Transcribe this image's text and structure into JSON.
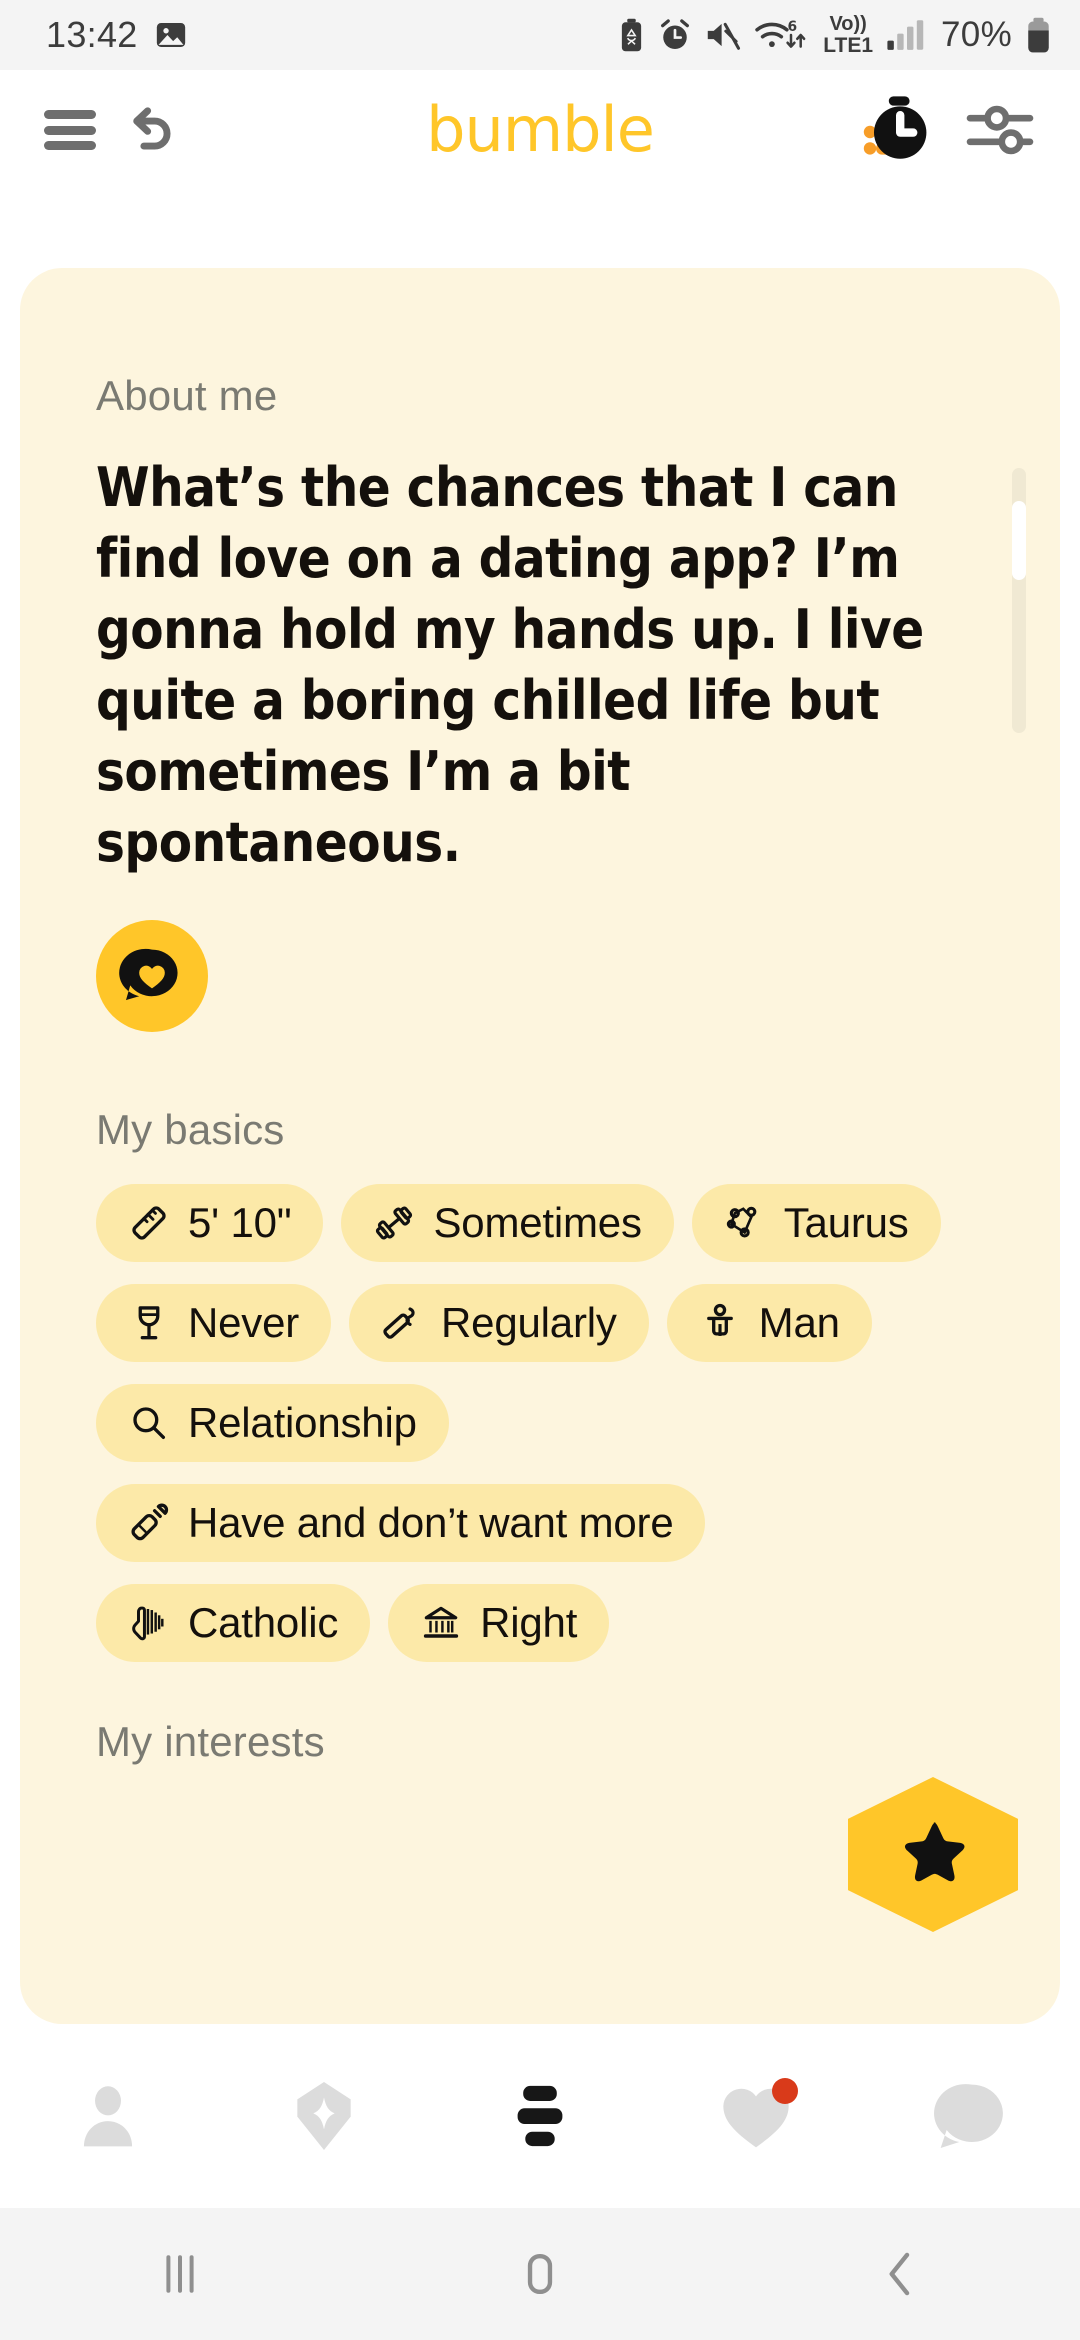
{
  "status_bar": {
    "time": "13:42",
    "battery_percent": "70%",
    "network_label": "LTE1",
    "volte_label": "Vo))",
    "wifi_generation": "6",
    "icons": [
      "screenshot-icon",
      "battery-saver-icon",
      "alarm-icon",
      "mute-icon",
      "wifi-icon",
      "volte-icon",
      "signal-icon",
      "battery-icon"
    ]
  },
  "app_bar": {
    "logo": "bumble",
    "menu_icon": "hamburger-menu-icon",
    "rewind_icon": "rewind-arrow-icon",
    "timer_icon": "stopwatch-icon",
    "filter_icon": "filter-sliders-icon",
    "brand_color": "#FFC629"
  },
  "profile": {
    "about_label": "About me",
    "bio": "What’s the chances that I can find love on a dating app? I’m gonna hold my hands up. I live quite a boring chilled life but sometimes I’m a bit spontaneous.",
    "chat_button_icon": "chat-heart-icon",
    "basics_label": "My basics",
    "basics": [
      {
        "label": "5' 10\"",
        "icon": "ruler-icon"
      },
      {
        "label": "Sometimes",
        "icon": "dumbbell-icon"
      },
      {
        "label": "Taurus",
        "icon": "constellation-icon"
      },
      {
        "label": "Never",
        "icon": "wine-glass-icon"
      },
      {
        "label": "Regularly",
        "icon": "cigarette-icon"
      },
      {
        "label": "Man",
        "icon": "person-gender-icon"
      },
      {
        "label": "Relationship",
        "icon": "magnifier-icon"
      },
      {
        "label": "Have and don’t want more",
        "icon": "baby-bottle-icon"
      },
      {
        "label": "Catholic",
        "icon": "praying-hands-icon"
      },
      {
        "label": "Right",
        "icon": "government-building-icon"
      }
    ],
    "interests_label": "My interests",
    "superswipe_icon": "star-icon",
    "card_background": "#FDF5DE",
    "chip_background": "#FCE9A8"
  },
  "tab_bar": {
    "tabs": [
      {
        "name": "profile",
        "icon": "person-icon",
        "active": false,
        "badge": false
      },
      {
        "name": "premium",
        "icon": "diamond-icon",
        "active": false,
        "badge": false
      },
      {
        "name": "discover",
        "icon": "bumble-bee-icon",
        "active": true,
        "badge": false
      },
      {
        "name": "likes",
        "icon": "heart-icon",
        "active": false,
        "badge": true
      },
      {
        "name": "chats",
        "icon": "chat-bubble-icon",
        "active": false,
        "badge": false
      }
    ],
    "badge_color": "#D93A1A"
  },
  "android_nav": {
    "recents_icon": "recents-icon",
    "home_icon": "home-icon",
    "back_icon": "back-icon"
  }
}
